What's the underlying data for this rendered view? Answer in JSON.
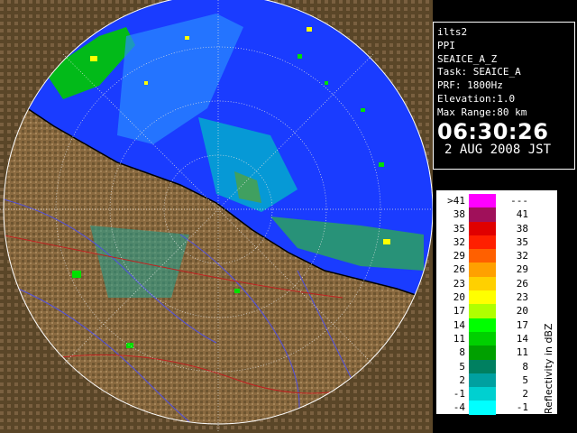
{
  "info": {
    "lines": [
      "ilts2",
      "PPI",
      "SEAICE_A_Z",
      "Task: SEAICE_A",
      "PRF: 1800Hz",
      "Elevation:1.0",
      "Max Range:80 km"
    ],
    "time": "06:30:26",
    "date": "2 AUG 2008 JST"
  },
  "scale": {
    "title": "Reflectivity in dBZ",
    "rows": [
      {
        "lo": ">41",
        "hi": "---",
        "color": "#ff00ff"
      },
      {
        "lo": "38",
        "hi": "41",
        "color": "#a0105a"
      },
      {
        "lo": "35",
        "hi": "38",
        "color": "#e00000"
      },
      {
        "lo": "32",
        "hi": "35",
        "color": "#ff2000"
      },
      {
        "lo": "29",
        "hi": "32",
        "color": "#ff6000"
      },
      {
        "lo": "26",
        "hi": "29",
        "color": "#ffa000"
      },
      {
        "lo": "23",
        "hi": "26",
        "color": "#ffd000"
      },
      {
        "lo": "20",
        "hi": "23",
        "color": "#ffff00"
      },
      {
        "lo": "17",
        "hi": "20",
        "color": "#b0ff00"
      },
      {
        "lo": "14",
        "hi": "17",
        "color": "#00ff00"
      },
      {
        "lo": "11",
        "hi": "14",
        "color": "#00d000"
      },
      {
        "lo": "8",
        "hi": "11",
        "color": "#00a000"
      },
      {
        "lo": "5",
        "hi": "8",
        "color": "#008060"
      },
      {
        "lo": "2",
        "hi": "5",
        "color": "#00a0a0"
      },
      {
        "lo": "-1",
        "hi": "2",
        "color": "#00d0d0"
      },
      {
        "lo": "-4",
        "hi": "-1",
        "color": "#00ffff"
      }
    ]
  },
  "colors": {
    "sea": "#2a5cff",
    "land": "#8a6a40",
    "echo_green": "#00c800",
    "echo_cyan": "#00d8d8",
    "echo_yellow": "#ffff00",
    "range_ring": "#ffffff"
  }
}
